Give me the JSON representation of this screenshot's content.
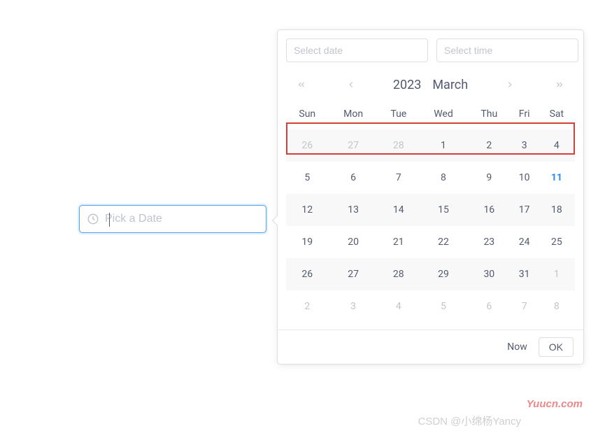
{
  "input": {
    "placeholder": "Pick a Date",
    "value": ""
  },
  "popup": {
    "date_placeholder": "Select date",
    "time_placeholder": "Select time",
    "year": "2023",
    "month": "March",
    "weekdays": [
      "Sun",
      "Mon",
      "Tue",
      "Wed",
      "Thu",
      "Fri",
      "Sat"
    ],
    "weeks": [
      {
        "days": [
          {
            "n": "26",
            "other": true
          },
          {
            "n": "27",
            "other": true
          },
          {
            "n": "28",
            "other": true
          },
          {
            "n": "1"
          },
          {
            "n": "2"
          },
          {
            "n": "3"
          },
          {
            "n": "4"
          }
        ]
      },
      {
        "days": [
          {
            "n": "5"
          },
          {
            "n": "6"
          },
          {
            "n": "7"
          },
          {
            "n": "8"
          },
          {
            "n": "9"
          },
          {
            "n": "10"
          },
          {
            "n": "11",
            "today": true
          }
        ]
      },
      {
        "days": [
          {
            "n": "12"
          },
          {
            "n": "13"
          },
          {
            "n": "14"
          },
          {
            "n": "15"
          },
          {
            "n": "16"
          },
          {
            "n": "17"
          },
          {
            "n": "18"
          }
        ],
        "highlight": true
      },
      {
        "days": [
          {
            "n": "19"
          },
          {
            "n": "20"
          },
          {
            "n": "21"
          },
          {
            "n": "22"
          },
          {
            "n": "23"
          },
          {
            "n": "24"
          },
          {
            "n": "25"
          }
        ]
      },
      {
        "days": [
          {
            "n": "26"
          },
          {
            "n": "27"
          },
          {
            "n": "28"
          },
          {
            "n": "29"
          },
          {
            "n": "30"
          },
          {
            "n": "31"
          },
          {
            "n": "1",
            "other": true
          }
        ]
      },
      {
        "days": [
          {
            "n": "2",
            "other": true
          },
          {
            "n": "3",
            "other": true
          },
          {
            "n": "4",
            "other": true
          },
          {
            "n": "5",
            "other": true
          },
          {
            "n": "6",
            "other": true
          },
          {
            "n": "7",
            "other": true
          },
          {
            "n": "8",
            "other": true
          }
        ]
      }
    ],
    "now_label": "Now",
    "ok_label": "OK"
  },
  "watermarks": {
    "site": "Yuucn.com",
    "author": "CSDN @小绵杨Yancy"
  }
}
